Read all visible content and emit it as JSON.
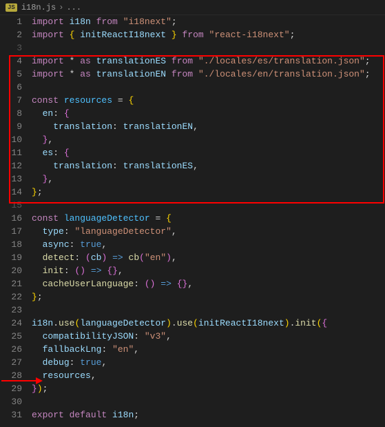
{
  "breadcrumb": {
    "badge": "JS",
    "file": "i18n.js",
    "chevron": "›",
    "suffix": "..."
  },
  "code": {
    "lines": [
      {
        "n": 1,
        "tokens": [
          [
            "kw",
            "import"
          ],
          [
            "pun",
            " "
          ],
          [
            "var",
            "i18n"
          ],
          [
            "pun",
            " "
          ],
          [
            "kw",
            "from"
          ],
          [
            "pun",
            " "
          ],
          [
            "str",
            "\"i18next\""
          ],
          [
            "pun",
            ";"
          ]
        ]
      },
      {
        "n": 2,
        "tokens": [
          [
            "kw",
            "import"
          ],
          [
            "pun",
            " "
          ],
          [
            "brace",
            "{"
          ],
          [
            "pun",
            " "
          ],
          [
            "var",
            "initReactI18next"
          ],
          [
            "pun",
            " "
          ],
          [
            "brace",
            "}"
          ],
          [
            "pun",
            " "
          ],
          [
            "kw",
            "from"
          ],
          [
            "pun",
            " "
          ],
          [
            "str",
            "\"react-i18next\""
          ],
          [
            "pun",
            ";"
          ]
        ]
      },
      {
        "n": 3,
        "tokens": [],
        "dim": true
      },
      {
        "n": 4,
        "tokens": [
          [
            "kw",
            "import"
          ],
          [
            "pun",
            " "
          ],
          [
            "pun",
            "*"
          ],
          [
            "pun",
            " "
          ],
          [
            "kw",
            "as"
          ],
          [
            "pun",
            " "
          ],
          [
            "var",
            "translationES"
          ],
          [
            "pun",
            " "
          ],
          [
            "kw",
            "from"
          ],
          [
            "pun",
            " "
          ],
          [
            "str",
            "\"./locales/es/translation.json\""
          ],
          [
            "pun",
            ";"
          ]
        ]
      },
      {
        "n": 5,
        "tokens": [
          [
            "kw",
            "import"
          ],
          [
            "pun",
            " "
          ],
          [
            "pun",
            "*"
          ],
          [
            "pun",
            " "
          ],
          [
            "kw",
            "as"
          ],
          [
            "pun",
            " "
          ],
          [
            "var",
            "translationEN"
          ],
          [
            "pun",
            " "
          ],
          [
            "kw",
            "from"
          ],
          [
            "pun",
            " "
          ],
          [
            "str",
            "\"./locales/en/translation.json\""
          ],
          [
            "pun",
            ";"
          ]
        ]
      },
      {
        "n": 6,
        "tokens": []
      },
      {
        "n": 7,
        "tokens": [
          [
            "kw",
            "const"
          ],
          [
            "pun",
            " "
          ],
          [
            "obj",
            "resources"
          ],
          [
            "pun",
            " "
          ],
          [
            "pun",
            "="
          ],
          [
            "pun",
            " "
          ],
          [
            "brace",
            "{"
          ]
        ]
      },
      {
        "n": 8,
        "tokens": [
          [
            "pun",
            "  "
          ],
          [
            "prop",
            "en"
          ],
          [
            "pun",
            ":"
          ],
          [
            "pun",
            " "
          ],
          [
            "brace2",
            "{"
          ]
        ]
      },
      {
        "n": 9,
        "tokens": [
          [
            "pun",
            "    "
          ],
          [
            "prop",
            "translation"
          ],
          [
            "pun",
            ":"
          ],
          [
            "pun",
            " "
          ],
          [
            "var",
            "translationEN"
          ],
          [
            "pun",
            ","
          ]
        ]
      },
      {
        "n": 10,
        "tokens": [
          [
            "pun",
            "  "
          ],
          [
            "brace2",
            "}"
          ],
          [
            "pun",
            ","
          ]
        ]
      },
      {
        "n": 11,
        "tokens": [
          [
            "pun",
            "  "
          ],
          [
            "prop",
            "es"
          ],
          [
            "pun",
            ":"
          ],
          [
            "pun",
            " "
          ],
          [
            "brace2",
            "{"
          ]
        ]
      },
      {
        "n": 12,
        "tokens": [
          [
            "pun",
            "    "
          ],
          [
            "prop",
            "translation"
          ],
          [
            "pun",
            ":"
          ],
          [
            "pun",
            " "
          ],
          [
            "var",
            "translationES"
          ],
          [
            "pun",
            ","
          ]
        ]
      },
      {
        "n": 13,
        "tokens": [
          [
            "pun",
            "  "
          ],
          [
            "brace2",
            "}"
          ],
          [
            "pun",
            ","
          ]
        ]
      },
      {
        "n": 14,
        "tokens": [
          [
            "brace",
            "}"
          ],
          [
            "pun",
            ";"
          ]
        ]
      },
      {
        "n": 15,
        "tokens": [],
        "dim": true
      },
      {
        "n": 16,
        "tokens": [
          [
            "kw",
            "const"
          ],
          [
            "pun",
            " "
          ],
          [
            "obj",
            "languageDetector"
          ],
          [
            "pun",
            " "
          ],
          [
            "pun",
            "="
          ],
          [
            "pun",
            " "
          ],
          [
            "brace",
            "{"
          ]
        ]
      },
      {
        "n": 17,
        "tokens": [
          [
            "pun",
            "  "
          ],
          [
            "prop",
            "type"
          ],
          [
            "pun",
            ":"
          ],
          [
            "pun",
            " "
          ],
          [
            "str",
            "\"languageDetector\""
          ],
          [
            "pun",
            ","
          ]
        ]
      },
      {
        "n": 18,
        "tokens": [
          [
            "pun",
            "  "
          ],
          [
            "prop",
            "async"
          ],
          [
            "pun",
            ":"
          ],
          [
            "pun",
            " "
          ],
          [
            "bool",
            "true"
          ],
          [
            "pun",
            ","
          ]
        ]
      },
      {
        "n": 19,
        "tokens": [
          [
            "pun",
            "  "
          ],
          [
            "fn",
            "detect"
          ],
          [
            "pun",
            ":"
          ],
          [
            "pun",
            " "
          ],
          [
            "paren2",
            "("
          ],
          [
            "var",
            "cb"
          ],
          [
            "paren2",
            ")"
          ],
          [
            "pun",
            " "
          ],
          [
            "bool",
            "=>"
          ],
          [
            "pun",
            " "
          ],
          [
            "fn",
            "cb"
          ],
          [
            "paren2",
            "("
          ],
          [
            "str",
            "\"en\""
          ],
          [
            "paren2",
            ")"
          ],
          [
            "pun",
            ","
          ]
        ]
      },
      {
        "n": 20,
        "tokens": [
          [
            "pun",
            "  "
          ],
          [
            "fn",
            "init"
          ],
          [
            "pun",
            ":"
          ],
          [
            "pun",
            " "
          ],
          [
            "paren2",
            "("
          ],
          [
            "paren2",
            ")"
          ],
          [
            "pun",
            " "
          ],
          [
            "bool",
            "=>"
          ],
          [
            "pun",
            " "
          ],
          [
            "brace2",
            "{"
          ],
          [
            "brace2",
            "}"
          ],
          [
            "pun",
            ","
          ]
        ]
      },
      {
        "n": 21,
        "tokens": [
          [
            "pun",
            "  "
          ],
          [
            "fn",
            "cacheUserLanguage"
          ],
          [
            "pun",
            ":"
          ],
          [
            "pun",
            " "
          ],
          [
            "paren2",
            "("
          ],
          [
            "paren2",
            ")"
          ],
          [
            "pun",
            " "
          ],
          [
            "bool",
            "=>"
          ],
          [
            "pun",
            " "
          ],
          [
            "brace2",
            "{"
          ],
          [
            "brace2",
            "}"
          ],
          [
            "pun",
            ","
          ]
        ]
      },
      {
        "n": 22,
        "tokens": [
          [
            "brace",
            "}"
          ],
          [
            "pun",
            ";"
          ]
        ]
      },
      {
        "n": 23,
        "tokens": []
      },
      {
        "n": 24,
        "tokens": [
          [
            "var",
            "i18n"
          ],
          [
            "pun",
            "."
          ],
          [
            "fn",
            "use"
          ],
          [
            "paren1",
            "("
          ],
          [
            "var",
            "languageDetector"
          ],
          [
            "paren1",
            ")"
          ],
          [
            "pun",
            "."
          ],
          [
            "fn",
            "use"
          ],
          [
            "paren1",
            "("
          ],
          [
            "var",
            "initReactI18next"
          ],
          [
            "paren1",
            ")"
          ],
          [
            "pun",
            "."
          ],
          [
            "fn",
            "init"
          ],
          [
            "paren1",
            "("
          ],
          [
            "brace2",
            "{"
          ]
        ]
      },
      {
        "n": 25,
        "tokens": [
          [
            "pun",
            "  "
          ],
          [
            "prop",
            "compatibilityJSON"
          ],
          [
            "pun",
            ":"
          ],
          [
            "pun",
            " "
          ],
          [
            "str",
            "\"v3\""
          ],
          [
            "pun",
            ","
          ]
        ]
      },
      {
        "n": 26,
        "tokens": [
          [
            "pun",
            "  "
          ],
          [
            "prop",
            "fallbackLng"
          ],
          [
            "pun",
            ":"
          ],
          [
            "pun",
            " "
          ],
          [
            "str",
            "\"en\""
          ],
          [
            "pun",
            ","
          ]
        ]
      },
      {
        "n": 27,
        "tokens": [
          [
            "pun",
            "  "
          ],
          [
            "prop",
            "debug"
          ],
          [
            "pun",
            ":"
          ],
          [
            "pun",
            " "
          ],
          [
            "bool",
            "true"
          ],
          [
            "pun",
            ","
          ]
        ]
      },
      {
        "n": 28,
        "tokens": [
          [
            "pun",
            "  "
          ],
          [
            "var",
            "resources"
          ],
          [
            "pun",
            ","
          ]
        ]
      },
      {
        "n": 29,
        "tokens": [
          [
            "brace2",
            "}"
          ],
          [
            "paren1",
            ")"
          ],
          [
            "pun",
            ";"
          ]
        ]
      },
      {
        "n": 30,
        "tokens": []
      },
      {
        "n": 31,
        "tokens": [
          [
            "kw",
            "export"
          ],
          [
            "pun",
            " "
          ],
          [
            "kw",
            "default"
          ],
          [
            "pun",
            " "
          ],
          [
            "var",
            "i18n"
          ],
          [
            "pun",
            ";"
          ]
        ]
      }
    ]
  }
}
